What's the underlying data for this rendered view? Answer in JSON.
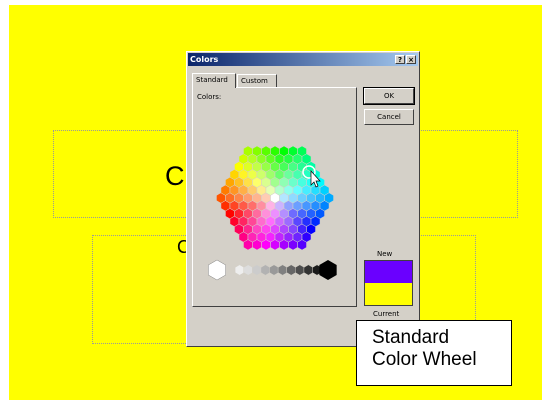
{
  "slide": {
    "background": "#ffff00",
    "title_glyph": "C",
    "body_glyph": "C"
  },
  "dialog": {
    "title": "Colors",
    "help_label": "?",
    "close_label": "×",
    "tabs": [
      {
        "label": "Standard",
        "active": true
      },
      {
        "label": "Custom",
        "active": false
      }
    ],
    "colors_label": "Colors:",
    "ok_label": "OK",
    "cancel_label": "Cancel",
    "new_label": "New",
    "current_label": "Current",
    "new_color": "#6a00ff",
    "current_color": "#ffff00"
  },
  "callout": {
    "line1": "Standard",
    "line2": "Color Wheel"
  }
}
